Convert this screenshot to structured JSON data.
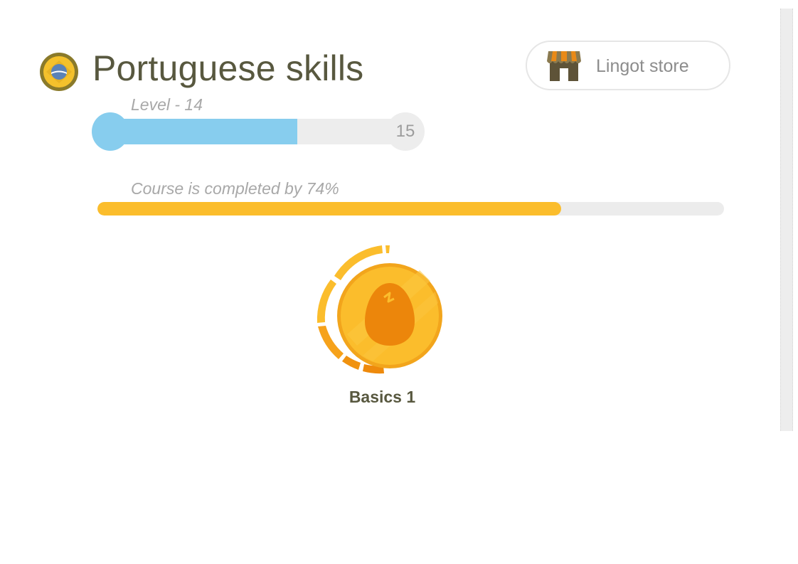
{
  "header": {
    "title": "Portuguese skills",
    "flag_icon": "brazil-flag-icon",
    "store_button": {
      "label": "Lingot store",
      "icon": "shop-icon"
    }
  },
  "level": {
    "label": "Level - 14",
    "current": 14,
    "next": "15",
    "progress_fraction": 0.64
  },
  "course": {
    "label": "Course is completed by 74%",
    "percent": 74
  },
  "skills": [
    {
      "label": "Basics 1",
      "icon": "egg-icon",
      "strength_fraction": 0.7
    }
  ],
  "colors": {
    "level_fill": "#87cdee",
    "course_fill": "#fbbd2c",
    "skill_gold": "#fbbd2c",
    "skill_orange": "#ee8a0c",
    "title_text": "#58583f"
  }
}
